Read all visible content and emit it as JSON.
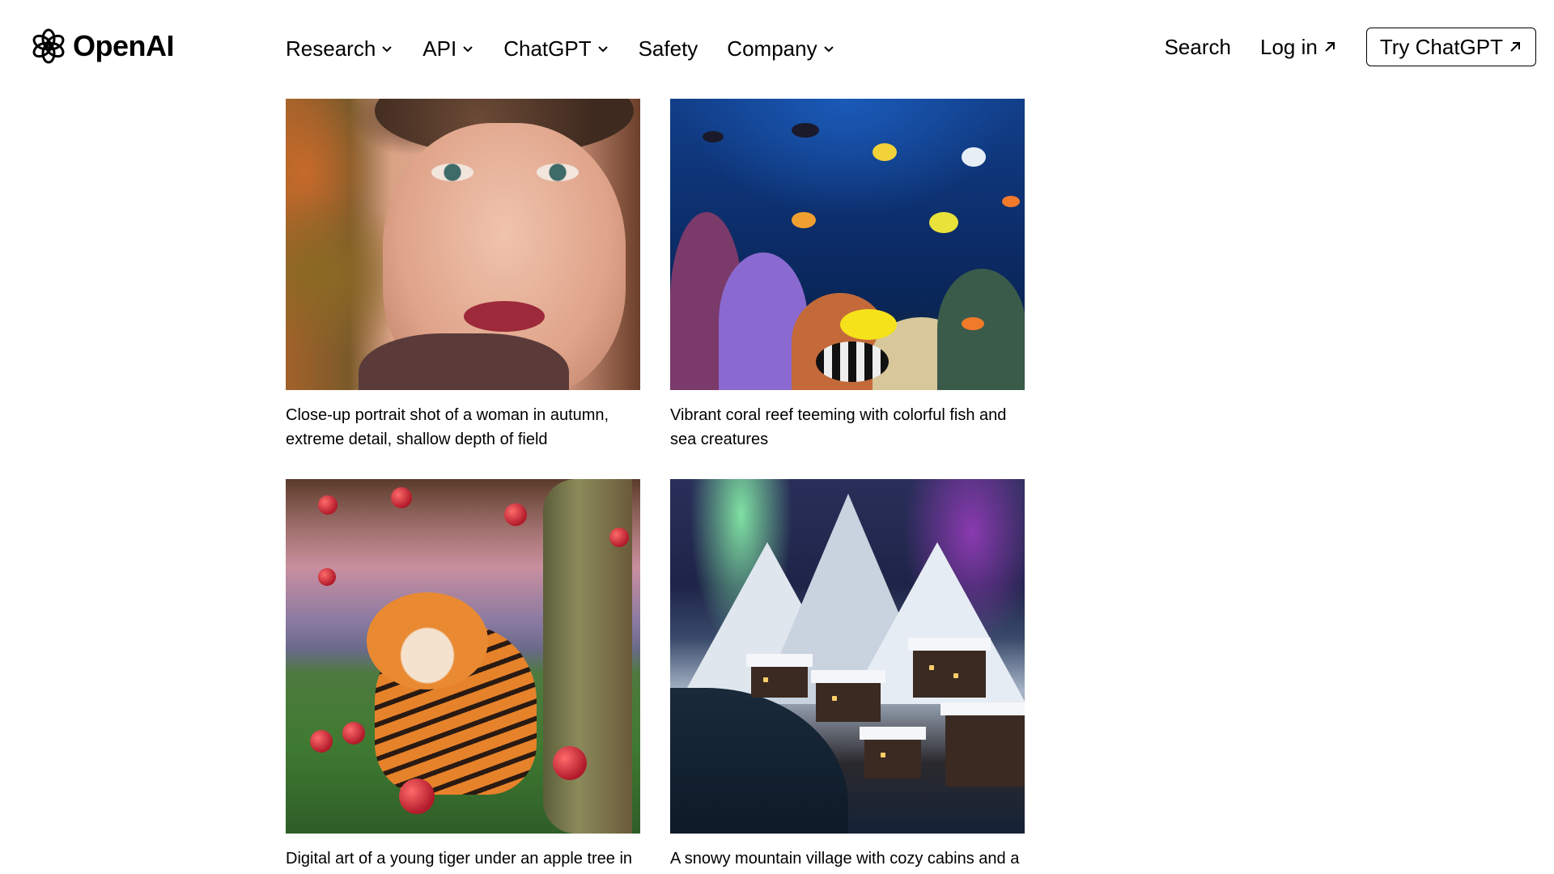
{
  "brand": {
    "name": "OpenAI"
  },
  "nav": {
    "items": [
      {
        "label": "Research",
        "has_dropdown": true
      },
      {
        "label": "API",
        "has_dropdown": true
      },
      {
        "label": "ChatGPT",
        "has_dropdown": true
      },
      {
        "label": "Safety",
        "has_dropdown": false
      },
      {
        "label": "Company",
        "has_dropdown": true
      }
    ],
    "search_label": "Search",
    "login_label": "Log in",
    "try_label": "Try ChatGPT"
  },
  "gallery": {
    "cards": [
      {
        "caption": "Close-up portrait shot of a woman in autumn, extreme detail, shallow depth of field",
        "image": "woman-autumn-portrait"
      },
      {
        "caption": "Vibrant coral reef teeming with colorful fish and sea creatures",
        "image": "coral-reef"
      },
      {
        "caption": "Digital art of a young tiger under an apple tree in a matte painting style with gorgeous details",
        "image": "tiger-apple-tree"
      },
      {
        "caption": "A snowy mountain village with cozy cabins and a northern lights display, high detail and",
        "image": "snowy-village-aurora"
      }
    ]
  },
  "colors": {
    "text": "#000000",
    "background": "#ffffff",
    "button_border": "#000000"
  },
  "icons": {
    "logo": "openai-logo-icon",
    "dropdown": "chevron-down-icon",
    "external": "arrow-up-right-icon"
  }
}
